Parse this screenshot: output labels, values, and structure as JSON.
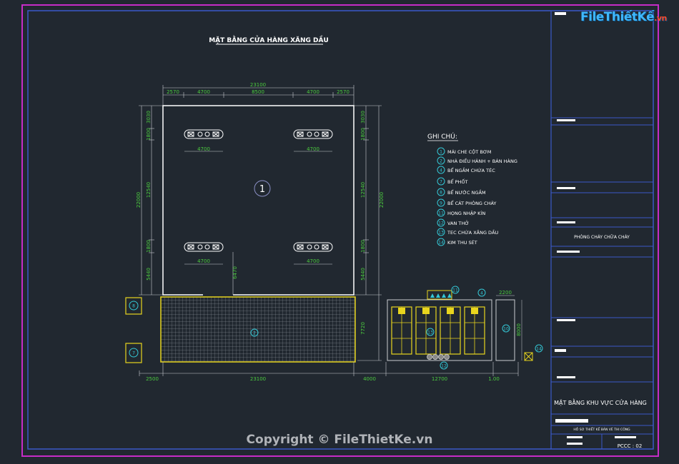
{
  "drawing": {
    "title": "MẶT BẰNG CỬA HÀNG XĂNG DẦU",
    "notes_title": "GHI CHÚ:",
    "marker_main": "1",
    "notes": [
      {
        "num": "1",
        "text": "MÁI CHE CỘT BƠM"
      },
      {
        "num": "2",
        "text": "NHÀ ĐIỀU HÀNH + BÁN HÀNG"
      },
      {
        "num": "4",
        "text": "BỂ NGẦM CHỨA TÉC"
      },
      {
        "num": "7",
        "text": "BỂ PHỐT"
      },
      {
        "num": "8",
        "text": "BỂ NƯỚC NGẦM"
      },
      {
        "num": "9",
        "text": "BỂ CÁT PHÒNG CHÁY"
      },
      {
        "num": "11",
        "text": "HỌNG NHẬP KÍN"
      },
      {
        "num": "12",
        "text": "VAN THỞ"
      },
      {
        "num": "13",
        "text": "TEC CHỨA XĂNG DẦU"
      },
      {
        "num": "14",
        "text": "KIM THU SÉT"
      }
    ],
    "dims": {
      "top_total": "23100",
      "top_a": "2570",
      "top_b": "4700",
      "top_c": "8500",
      "top_d": "4700",
      "top_e": "2570",
      "pump_width": "4700",
      "left_total": "22000",
      "left_a": "3030",
      "left_b": "1800",
      "left_c": "12540",
      "left_d": "1800",
      "left_e": "5440",
      "mid_v": "6470",
      "bottom_a": "2500",
      "bottom_b": "23100",
      "bottom_c": "4000",
      "bottom_d": "12700",
      "bottom_e": "1.00",
      "right_h": "7720",
      "tank_right_w": "2200",
      "tank_right_h": "8000"
    },
    "markers": {
      "m2": "2",
      "m8": "8",
      "m7": "7",
      "m11": "11",
      "m4": "4",
      "m13": "13",
      "m12": "12",
      "m10": "10",
      "m14": "14"
    }
  },
  "title_block": {
    "subject": "PHÒNG CHÁY CHỮA CHÁY",
    "drawing_name": "MẶT BẰNG KHU VỰC CỬA HÀNG",
    "stage": "HỒ SƠ THIẾT KẾ BẢN VẼ THI CÔNG",
    "sheet_no": "PCCC : 02"
  },
  "logo": {
    "text": "FileThiếtKế",
    "suffix": ".vn"
  },
  "watermark": "Copyright © FileThietKe.vn",
  "colors": {
    "frame": "#c72cc7",
    "border": "#3a59c9",
    "dim": "#4ccb3f",
    "callout": "#34c8d6",
    "tank": "#e8d51e",
    "bg": "#212830"
  }
}
